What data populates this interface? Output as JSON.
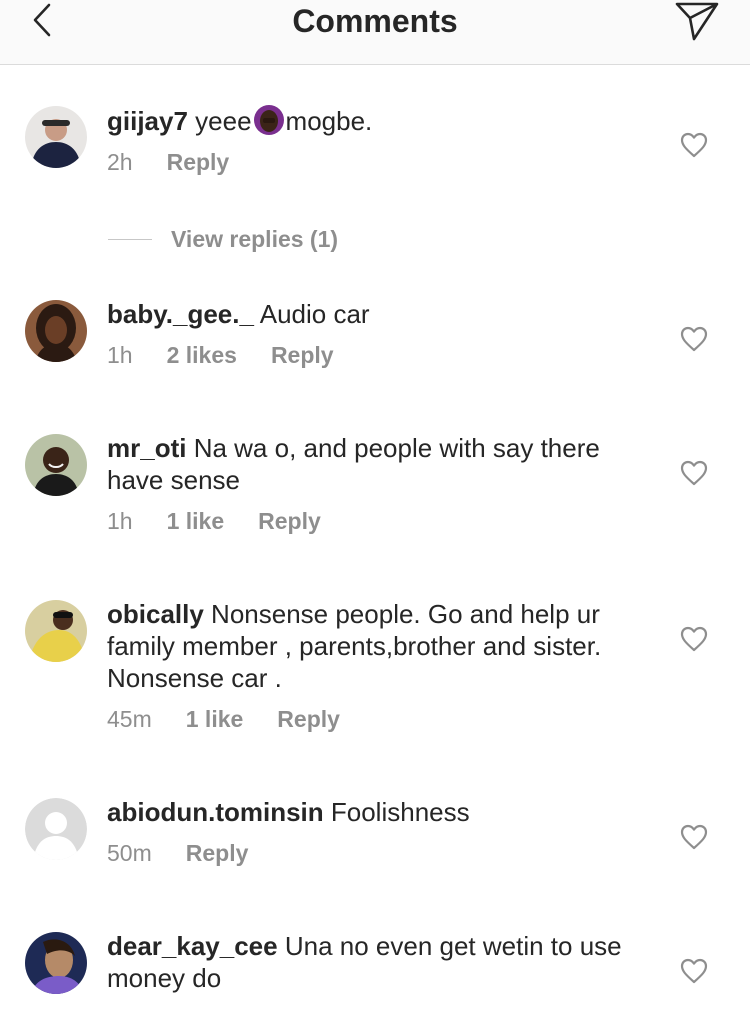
{
  "header": {
    "title": "Comments",
    "back_icon": "chevron-left-icon",
    "send_icon": "paper-plane-icon"
  },
  "comments": [
    {
      "username": "giijay7",
      "text_before": " yeee",
      "emoji": "woman-facepalming-emoji",
      "text_after": "mogbe.",
      "time": "2h",
      "likes": "",
      "reply": "Reply",
      "avatar_color": "#1c2340"
    },
    {
      "username": "baby._gee._",
      "text": " Audio car",
      "time": "1h",
      "likes": "2 likes",
      "reply": "Reply",
      "avatar_color": "#4a2a1c"
    },
    {
      "username": "mr_oti",
      "text": " Na wa o, and people with say there have sense",
      "time": "1h",
      "likes": "1 like",
      "reply": "Reply",
      "avatar_color": "#6b7a5c"
    },
    {
      "username": "obically",
      "text": " Nonsense people. Go and help ur family member , parents,brother and sister. Nonsense car .",
      "time": "45m",
      "likes": "1 like",
      "reply": "Reply",
      "avatar_color": "#c9b54a"
    },
    {
      "username": "abiodun.tominsin",
      "text": " Foolishness",
      "time": "50m",
      "likes": "",
      "reply": "Reply",
      "avatar_color": "#dbdbdb"
    },
    {
      "username": "dear_kay_cee",
      "text": " Una no even get wetin to use money do",
      "time": "",
      "likes": "",
      "reply": "",
      "avatar_color": "#1e2a55"
    }
  ],
  "view_replies": "View replies (1)",
  "colors": {
    "text": "#262626",
    "muted": "#8e8e8e",
    "border": "#dbdbdb",
    "header_bg": "#fafafa"
  }
}
